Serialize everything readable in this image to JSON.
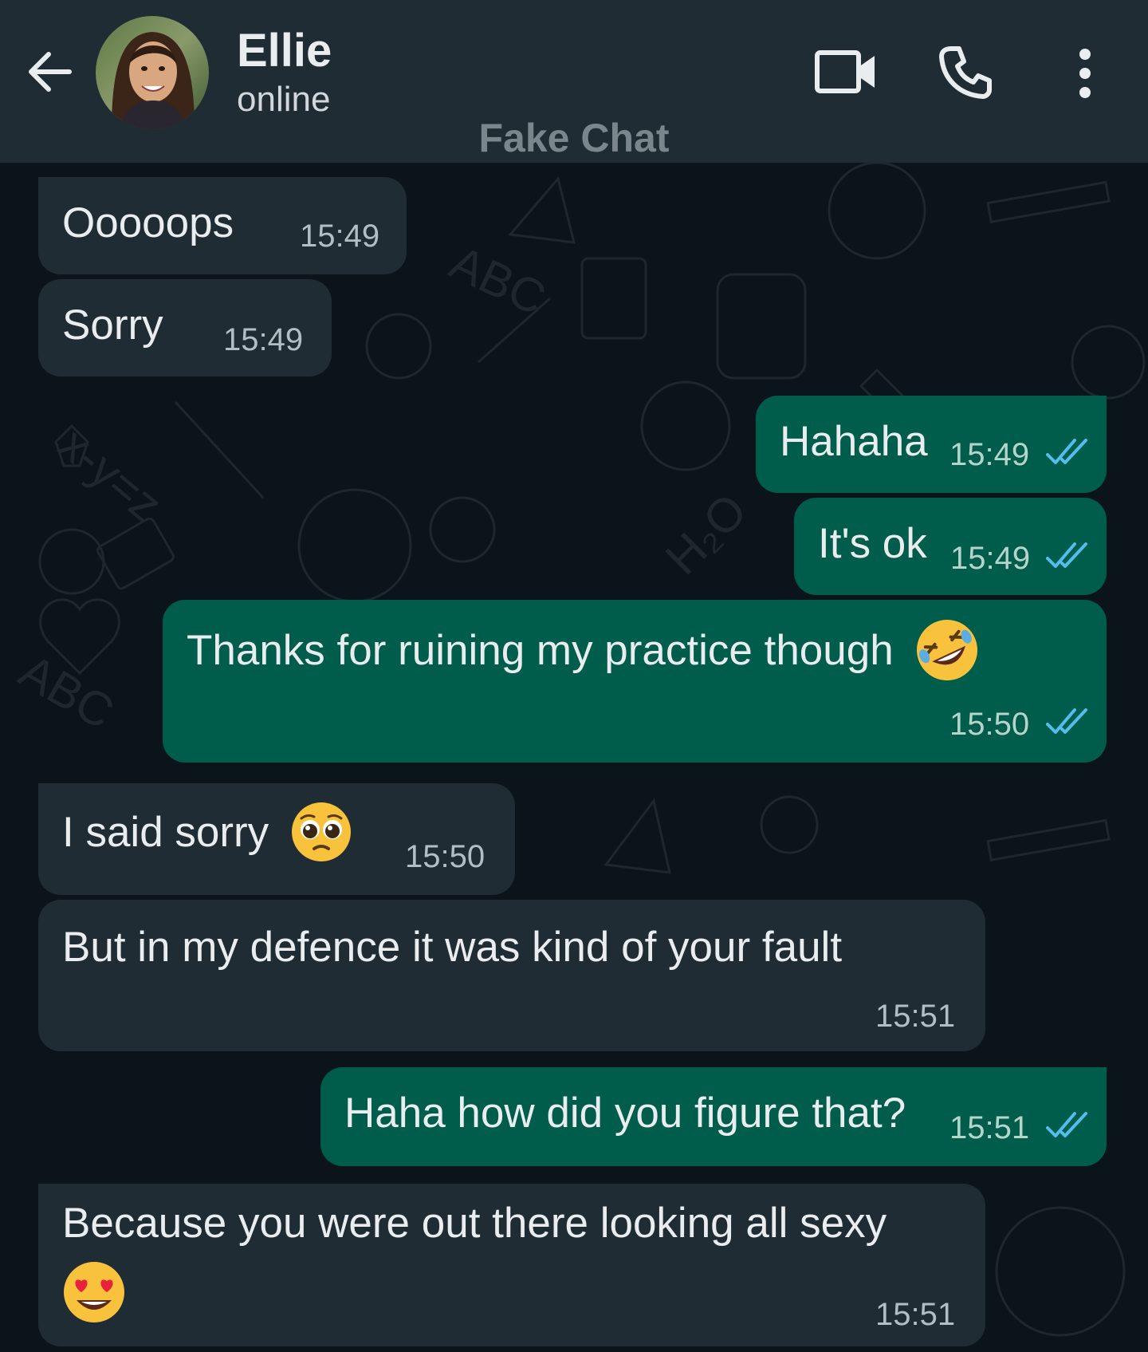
{
  "header": {
    "contact_name": "Ellie",
    "status": "online",
    "watermark": "Fake Chat",
    "icons": [
      "back-arrow-icon",
      "video-call-icon",
      "phone-icon",
      "more-vert-icon"
    ],
    "background": "#1f2c34"
  },
  "colors": {
    "incoming_bubble": "#1f2c34",
    "outgoing_bubble": "#005c4b",
    "chat_background": "#0b141a",
    "read_ticks": "#53bdeb"
  },
  "messages": [
    {
      "direction": "incoming",
      "text": "Ooooops",
      "time": "15:49"
    },
    {
      "direction": "incoming",
      "text": "Sorry",
      "time": "15:49"
    },
    {
      "direction": "outgoing",
      "text": "Hahaha",
      "time": "15:49",
      "status": "read"
    },
    {
      "direction": "outgoing",
      "text": "It's ok",
      "time": "15:49",
      "status": "read"
    },
    {
      "direction": "outgoing",
      "text": "Thanks for ruining my practice though",
      "emoji": "rolling-on-floor-laughing",
      "time": "15:50",
      "status": "read"
    },
    {
      "direction": "incoming",
      "text": "I said sorry",
      "emoji": "pleading-face",
      "time": "15:50"
    },
    {
      "direction": "incoming",
      "text": "But in my defence it was kind of your fault",
      "time": "15:51"
    },
    {
      "direction": "outgoing",
      "text": "Haha how did you figure that?",
      "time": "15:51",
      "status": "read"
    },
    {
      "direction": "incoming",
      "text": "Because you were out there looking all sexy",
      "emoji": "heart-eyes",
      "time": "15:51"
    }
  ]
}
